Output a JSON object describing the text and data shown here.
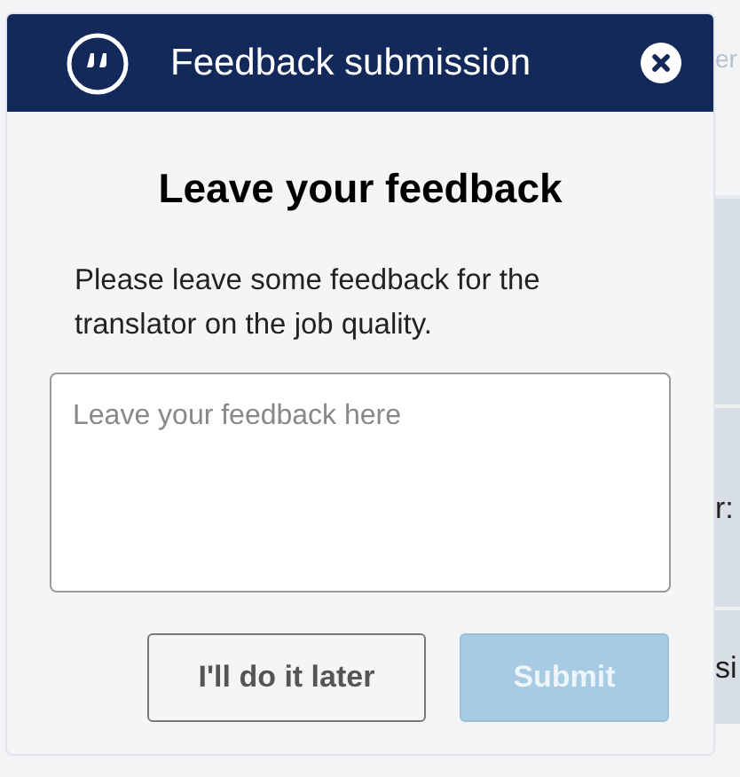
{
  "background": {
    "fragments": [
      {
        "text": "er"
      },
      {
        "text": "r:"
      },
      {
        "text": "si"
      }
    ]
  },
  "dialog": {
    "title": "Feedback submission",
    "heading": "Leave your feedback",
    "message": "Please leave some feedback for the translator on the job quality.",
    "feedback_field": {
      "placeholder": "Leave your feedback here"
    },
    "buttons": [
      {
        "label": "I'll do it later",
        "kind": "secondary",
        "disabled": false
      },
      {
        "label": "Submit",
        "kind": "primary",
        "disabled": true
      }
    ]
  }
}
